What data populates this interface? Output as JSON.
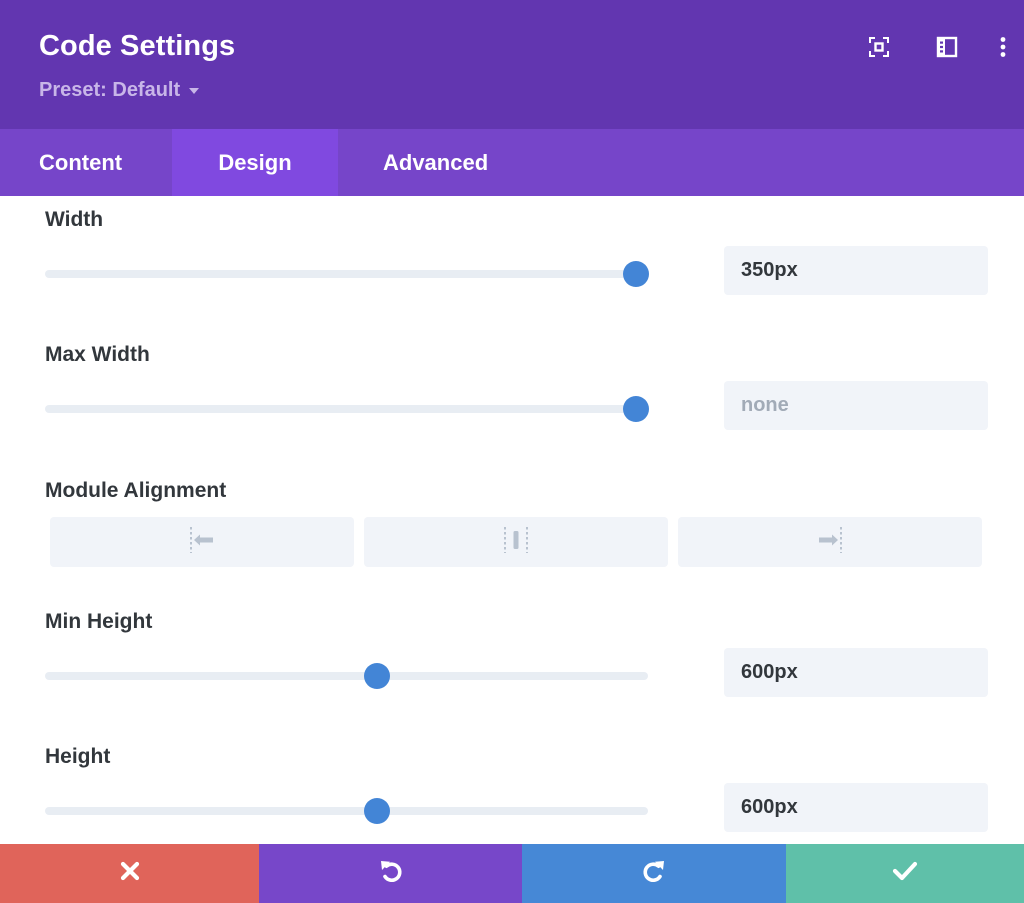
{
  "header": {
    "title": "Code Settings",
    "preset_label": "Preset: Default",
    "icons": [
      "focus-mode-icon",
      "sidebar-layout-icon",
      "more-options-icon"
    ]
  },
  "tabs": [
    {
      "label": "Content",
      "active": false
    },
    {
      "label": "Design",
      "active": true
    },
    {
      "label": "Advanced",
      "active": false
    }
  ],
  "settings": {
    "width": {
      "label": "Width",
      "value": "350px",
      "slider_fraction": 0.98
    },
    "max_width": {
      "label": "Max Width",
      "value": "",
      "placeholder": "none",
      "slider_fraction": 0.98
    },
    "module_alignment": {
      "label": "Module Alignment",
      "options": [
        {
          "name": "left",
          "icon": "align-left-icon"
        },
        {
          "name": "center",
          "icon": "align-center-icon"
        },
        {
          "name": "right",
          "icon": "align-right-icon"
        }
      ]
    },
    "min_height": {
      "label": "Min Height",
      "value": "600px",
      "slider_fraction": 0.55
    },
    "height": {
      "label": "Height",
      "value": "600px",
      "slider_fraction": 0.55
    }
  },
  "footer": {
    "buttons": [
      {
        "name": "cancel",
        "icon": "close-icon",
        "color": "#e0645a"
      },
      {
        "name": "undo",
        "icon": "undo-icon",
        "color": "#7747c9"
      },
      {
        "name": "redo",
        "icon": "redo-icon",
        "color": "#4688d6"
      },
      {
        "name": "save",
        "icon": "check-icon",
        "color": "#5fc0a9"
      }
    ]
  },
  "colors": {
    "header_bg": "#6236b0",
    "tab_bar_bg": "#7645c9",
    "active_tab_bg": "#8049e0",
    "slider_thumb": "#4385d6",
    "slider_track": "#e8edf3",
    "field_bg": "#f1f4f9"
  }
}
